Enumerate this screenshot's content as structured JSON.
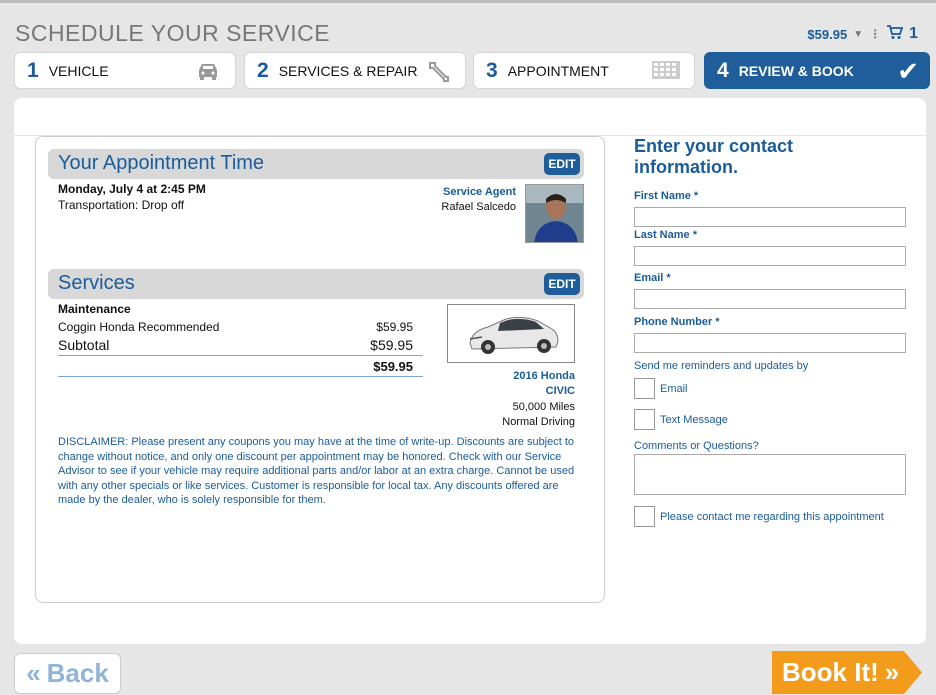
{
  "header": {
    "title": "SCHEDULE YOUR SERVICE",
    "cart_total": "$59.95",
    "cart_count": "1"
  },
  "steps": [
    {
      "num": "1",
      "label": "VEHICLE",
      "icon": "car-icon"
    },
    {
      "num": "2",
      "label": "SERVICES & REPAIR",
      "icon": "wrench-icon"
    },
    {
      "num": "3",
      "label": "APPOINTMENT",
      "icon": "calendar-icon"
    },
    {
      "num": "4",
      "label": "REVIEW & BOOK",
      "icon": "check-icon"
    }
  ],
  "appointment": {
    "heading": "Your Appointment Time",
    "edit_label": "EDIT",
    "date_time": "Monday, July 4 at 2:45 PM",
    "transportation": "Transportation: Drop off",
    "agent_label": "Service Agent",
    "agent_name": "Rafael Salcedo"
  },
  "services": {
    "heading": "Services",
    "edit_label": "EDIT",
    "category": "Maintenance",
    "item_name": "Coggin Honda Recommended",
    "item_price": "$59.95",
    "subtotal_label": "Subtotal",
    "subtotal_value": "$59.95",
    "total_value": "$59.95"
  },
  "vehicle": {
    "title_line1": "2016 Honda",
    "title_line2": "CIVIC",
    "mileage": "50,000 Miles",
    "driving": "Normal Driving"
  },
  "disclaimer": "DISCLAIMER: Please present any coupons you may have at the time of write-up. Discounts are subject to change without notice, and only one discount per appointment may be honored. Check with our Service Advisor to see if your vehicle may require additional parts and/or labor at an extra charge. Cannot be used with any other specials or like services. Customer is responsible for local tax. Any discounts offered are made by the dealer, who is solely responsible for them.",
  "contact": {
    "title": "Enter your contact information.",
    "first_name_label": "First Name *",
    "last_name_label": "Last Name *",
    "email_label": "Email *",
    "phone_label": "Phone Number *",
    "reminders_label": "Send me reminders and updates by",
    "email_option": "Email",
    "text_option": "Text Message",
    "comments_label": "Comments or Questions?",
    "contact_me_label": "Please contact me regarding this appointment"
  },
  "nav": {
    "back_label": "Back",
    "book_label": "Book It!"
  },
  "colors": {
    "brand_blue": "#1f5d9b",
    "accent_orange": "#f39c1c"
  }
}
